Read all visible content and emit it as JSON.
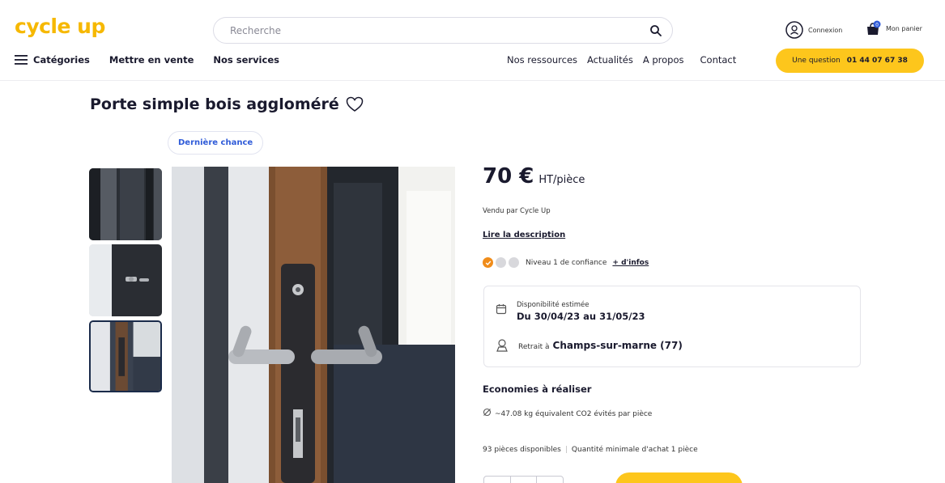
{
  "header": {
    "logo": "cycle up",
    "search_placeholder": "Recherche",
    "connexion": "Connexion",
    "cart": "Mon panier",
    "cart_count": "0"
  },
  "nav": {
    "categories": "Catégories",
    "sell": "Mettre en vente",
    "services": "Nos services",
    "resources": "Nos ressources",
    "news": "Actualités",
    "about": "A propos",
    "contact": "Contact",
    "question": "Une question",
    "phone": "01 44 07 67 38"
  },
  "product": {
    "title": "Porte simple bois aggloméré",
    "badge": "Dernière chance",
    "price": "70 €",
    "price_unit": "HT/pièce",
    "seller": "Vendu par Cycle Up",
    "description_link": "Lire la description",
    "trust_level": "Niveau 1 de confiance",
    "trust_more": "+ d'infos",
    "availability_label": "Disponibilité estimée",
    "availability_dates": "Du 30/04/23 au 31/05/23",
    "pickup_label": "Retrait à",
    "pickup_city": "Champs-sur-marne (77)",
    "savings_title": "Economies à réaliser",
    "co2": "~47.08 kg équivalent CO2 évités par pièce",
    "stock": "93 pièces disponibles",
    "min_qty": "Quantité minimale d'achat 1 pièce"
  },
  "colors": {
    "brand_yellow": "#fdc61c",
    "logo_yellow": "#f6b800",
    "trust_orange": "#f08c1a",
    "badge_blue": "#2f5bd8"
  }
}
